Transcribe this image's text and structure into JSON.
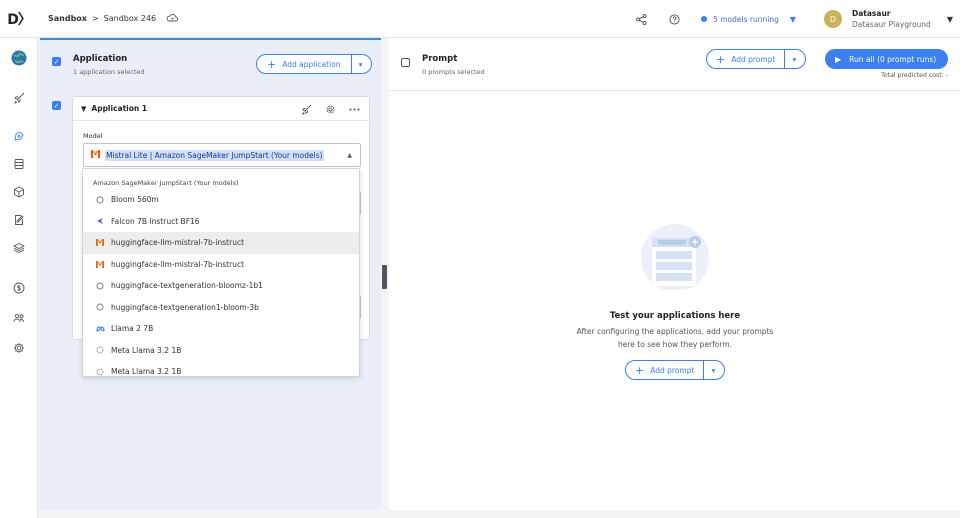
{
  "header": {
    "logo": "D〉",
    "breadcrumb": {
      "root": "Sandbox",
      "separator": ">",
      "current": "Sandbox 246"
    },
    "models_running": "5 models running",
    "user": {
      "initial": "D",
      "name": "Datasaur",
      "workspace": "Datasaur Playground"
    }
  },
  "application": {
    "title": "Application",
    "subtitle": "1 application selected",
    "add_label": "Add application",
    "card": {
      "title": "Application 1",
      "model_label": "Model",
      "selected_model": "Mistral Lite | Amazon SageMaker JumpStart (Your models)"
    },
    "dropdown": {
      "group": "Amazon SageMaker JumpStart (Your models)",
      "items": [
        {
          "label": "Bloom 560m",
          "icon": "bloom-icon"
        },
        {
          "label": "Falcon 7B Instruct BF16",
          "icon": "falcon-icon"
        },
        {
          "label": "huggingface-llm-mistral-7b-instruct",
          "icon": "mistral-icon"
        },
        {
          "label": "huggingface-llm-mistral-7b-instruct",
          "icon": "mistral-icon"
        },
        {
          "label": "huggingface-textgeneration-bloomz-1b1",
          "icon": "bloom-icon"
        },
        {
          "label": "huggingface-textgeneration1-bloom-3b",
          "icon": "bloom-icon"
        },
        {
          "label": "Llama 2 7B",
          "icon": "meta-icon"
        },
        {
          "label": "Meta Llama 3.2 1B",
          "icon": "llama-icon"
        },
        {
          "label": "Meta Llama 3.2 1B",
          "icon": "llama-icon"
        }
      ]
    }
  },
  "prompt": {
    "title": "Prompt",
    "subtitle": "0 prompts selected",
    "add_label": "Add prompt",
    "run_label": "Run all (0 prompt runs)",
    "cost": "Total predicted cost: -",
    "empty_title": "Test your applications here",
    "empty_text": "After configuring the applications, add your prompts here to see how they perform.",
    "empty_add_label": "Add prompt"
  },
  "colors": {
    "accent": "#3c7ff0",
    "panel": "#e9eef8",
    "highlight": "#cfe0ff"
  }
}
